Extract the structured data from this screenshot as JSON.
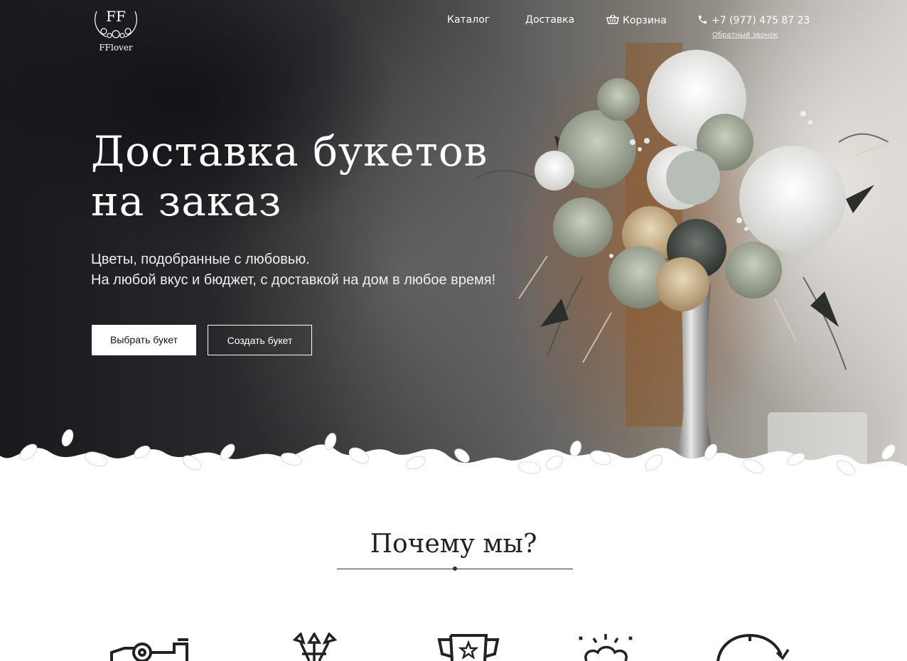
{
  "brand": {
    "monogram": "FF",
    "name": "FFlover"
  },
  "nav": {
    "catalog": "Каталог",
    "delivery": "Доставка",
    "cart": "Корзина",
    "phone": "+7 (977) 475 87 23",
    "callback": "Обратный звонок"
  },
  "hero": {
    "title_line1": "Доставка букетов",
    "title_line2": "на заказ",
    "subtitle_line1": "Цветы, подобранные с любовью.",
    "subtitle_line2": "На любой вкус и бюджет, с доставкой на дом в любое время!",
    "btn_choose": "Выбрать букет",
    "btn_create": "Создать букет"
  },
  "why": {
    "title": "Почему мы?"
  },
  "features": [
    {
      "icon": "delivery-truck-icon"
    },
    {
      "icon": "flowers-icon"
    },
    {
      "icon": "trophy-icon"
    },
    {
      "icon": "fresh-bouquet-icon"
    },
    {
      "icon": "clock-icon"
    }
  ],
  "colors": {
    "accent": "#ffffff",
    "text_dark": "#222222"
  }
}
